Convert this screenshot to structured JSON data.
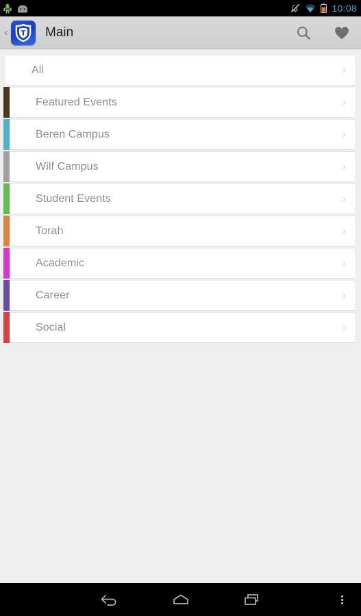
{
  "status_bar": {
    "time": "10:08",
    "notification_icons": [
      "android-robot-icon",
      "android-head-icon"
    ],
    "system_icons": [
      "silent-mode-icon",
      "wifi-icon",
      "battery-low-icon"
    ],
    "time_color": "#3ea8c8",
    "battery_color": "#e8762a",
    "wifi_color": "#3ea8c8"
  },
  "action_bar": {
    "back_chevron": "‹",
    "logo_name": "yeshiva-university-shield-logo",
    "title": "Main",
    "search_label": "Search",
    "favorites_label": "Favorites",
    "background": "#d4d4d4"
  },
  "list": {
    "chevron": "›",
    "items": [
      {
        "label": "All",
        "color": "transparent"
      },
      {
        "label": "Featured Events",
        "color": "#4a3a1a"
      },
      {
        "label": "Beren Campus",
        "color": "#4cb3cc"
      },
      {
        "label": "Wilf Campus",
        "color": "#a0a0a0"
      },
      {
        "label": "Student Events",
        "color": "#5cc04c"
      },
      {
        "label": "Torah",
        "color": "#e0823c"
      },
      {
        "label": "Academic",
        "color": "#d832d8"
      },
      {
        "label": "Career",
        "color": "#6b4ba8"
      },
      {
        "label": "Social",
        "color": "#d9413c"
      }
    ]
  },
  "nav_bar": {
    "back_label": "Back",
    "home_label": "Home",
    "recents_label": "Recent apps",
    "overflow_label": "More options"
  }
}
